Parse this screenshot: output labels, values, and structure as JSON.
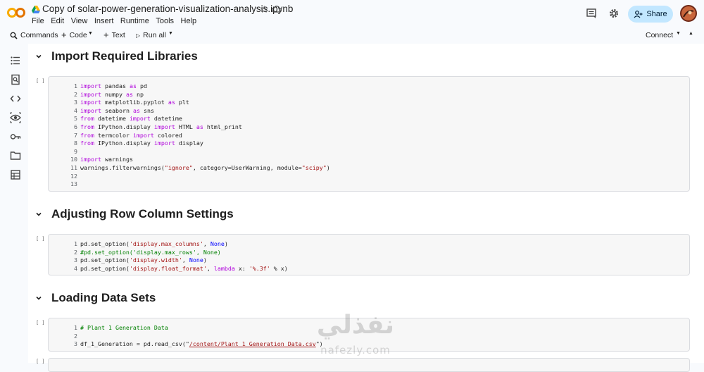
{
  "header": {
    "title": "Copy of solar-power-generation-visualization-analysis.ipynb",
    "menu": [
      "File",
      "Edit",
      "View",
      "Insert",
      "Runtime",
      "Tools",
      "Help"
    ],
    "share_label": "Share"
  },
  "toolbar": {
    "commands_label": "Commands",
    "code_label": "Code",
    "text_label": "Text",
    "run_all_label": "Run all",
    "connect_label": "Connect"
  },
  "sections": [
    {
      "heading": "Import Required Libraries",
      "run_marker": "[ ]",
      "lines": [
        "1",
        "2",
        "3",
        "4",
        "5",
        "6",
        "7",
        "8",
        "9",
        "10",
        "11",
        "12",
        "13"
      ]
    },
    {
      "heading": "Adjusting Row Column Settings",
      "run_marker": "[ ]",
      "lines": [
        "1",
        "2",
        "3",
        "4"
      ]
    },
    {
      "heading": "Loading Data Sets",
      "run_marker": "[ ]",
      "lines": [
        "1",
        "2",
        "3"
      ]
    }
  ],
  "code": {
    "c1": {
      "import": "import",
      "as": "as",
      "from": "from",
      "pandas": " pandas ",
      "pd": " pd",
      "numpy": " numpy ",
      "np": " np",
      "plt_mod": " matplotlib.pyplot ",
      "plt": " plt",
      "seaborn": " seaborn ",
      "sns": " sns",
      "datetime_mod": " datetime ",
      "datetime": " datetime",
      "ipd": " IPython.display ",
      "html": " HTML ",
      "html_print": " html_print",
      "termcolor": " termcolor ",
      "colored": " colored",
      "display": " display",
      "warnings": " warnings",
      "filter_pre": "warnings.filterwarnings(",
      "ignore": "\"ignore\"",
      "filter_mid": ", category=UserWarning, module=",
      "scipy": "\"scipy\"",
      "filter_end": ")"
    },
    "c2": {
      "set_pre": "pd.set_option(",
      "max_columns": "'display.max_columns'",
      "max_rows_comment": "#pd.set_option('display.max_rows', None)",
      "width": "'display.width'",
      "float_format": "'display.float_format'",
      "comma": ", ",
      "none": "None",
      "close": ")",
      "lambda": "lambda",
      "x_colon": " x: ",
      "fmt": "'%.3f'",
      "mod_x": " % x)"
    },
    "c3": {
      "comment": "# Plant 1 Generation Data",
      "assign": "df_1_Generation = pd.read_csv(\"",
      "path": "/content/Plant_1_Generation_Data.csv",
      "end": "\")"
    }
  },
  "watermark": {
    "arabic": "نفذلي",
    "latin": "nafezly.com"
  }
}
